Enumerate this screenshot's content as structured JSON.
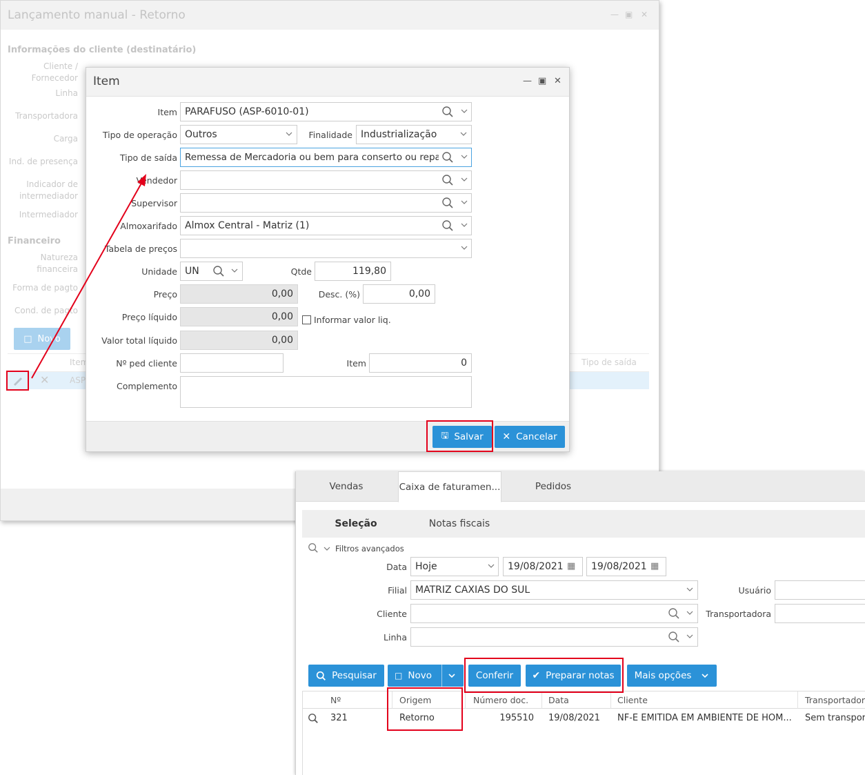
{
  "bg_window": {
    "title": "Lançamento manual - Retorno",
    "section_client": "Informações do cliente (destinatário)",
    "labels": [
      "Cliente / Fornecedor",
      "Linha",
      "Transportadora",
      "Carga",
      "Ind. de presença",
      "Indicador de intermediador",
      "Intermediador"
    ],
    "section_financial": "Financeiro",
    "financial_labels": [
      "Natureza financeira",
      "Forma de pagto",
      "Cond. de pagto"
    ],
    "novo_label": "Novo",
    "grid_header_item": "Item",
    "grid_header_tipo": "Tipo de saída",
    "grid_row_item": "ASP"
  },
  "dialog": {
    "title": "Item",
    "item_label": "Item",
    "item_value": "PARAFUSO (ASP-6010-01)",
    "tipo_operacao_label": "Tipo de operação",
    "tipo_operacao_value": "Outros",
    "finalidade_label": "Finalidade",
    "finalidade_value": "Industrialização",
    "tipo_saida_label": "Tipo de saída",
    "tipo_saida_value": "Remessa de Mercadoria ou bem para conserto ou reparo",
    "vendedor_label": "Vendedor",
    "supervisor_label": "Supervisor",
    "almoxarifado_label": "Almoxarifado",
    "almoxarifado_value": "Almox Central - Matriz (1)",
    "tabela_precos_label": "Tabela de preços",
    "unidade_label": "Unidade",
    "unidade_value": "UN",
    "qtde_label": "Qtde",
    "qtde_value": "119,80",
    "preco_label": "Preço",
    "preco_value": "0,00",
    "desc_label": "Desc. (%)",
    "desc_value": "0,00",
    "preco_liquido_label": "Preço líquido",
    "preco_liquido_value": "0,00",
    "informar_valor_label": "Informar valor liq.",
    "valor_total_label": "Valor total líquido",
    "valor_total_value": "0,00",
    "ped_cliente_label": "Nº ped cliente",
    "item2_label": "Item",
    "item2_value": "0",
    "complemento_label": "Complemento",
    "salvar_label": "Salvar",
    "cancelar_label": "Cancelar"
  },
  "window2": {
    "tabs": [
      "Vendas",
      "Caixa de faturamen...",
      "Pedidos"
    ],
    "subtabs": [
      "Seleção",
      "Notas fiscais"
    ],
    "filtros_label": "Filtros avançados",
    "data_label": "Data",
    "data_period": "Hoje",
    "date_from": "19/08/2021",
    "date_to": "19/08/2021",
    "filial_label": "Filial",
    "filial_value": "MATRIZ CAXIAS DO SUL",
    "usuario_label": "Usuário",
    "cliente_label": "Cliente",
    "transportadora_label": "Transportadora",
    "linha_label": "Linha",
    "btn_pesquisar": "Pesquisar",
    "btn_novo": "Novo",
    "btn_conferir": "Conferir",
    "btn_preparar": "Preparar notas",
    "btn_mais": "Mais opções",
    "columns": [
      "Nº",
      "Origem",
      "Número doc.",
      "Data",
      "Cliente",
      "Transportadora"
    ],
    "rows": [
      {
        "numero": "321",
        "origem": "Retorno",
        "numero_doc": "195510",
        "data": "19/08/2021",
        "cliente": "NF-E EMITIDA EM AMBIENTE DE HOM...",
        "transportadora": "Sem transport"
      }
    ]
  },
  "colors": {
    "accent": "#2b92d8",
    "highlight_box": "#e3001b",
    "arrow": "#e3001b"
  }
}
